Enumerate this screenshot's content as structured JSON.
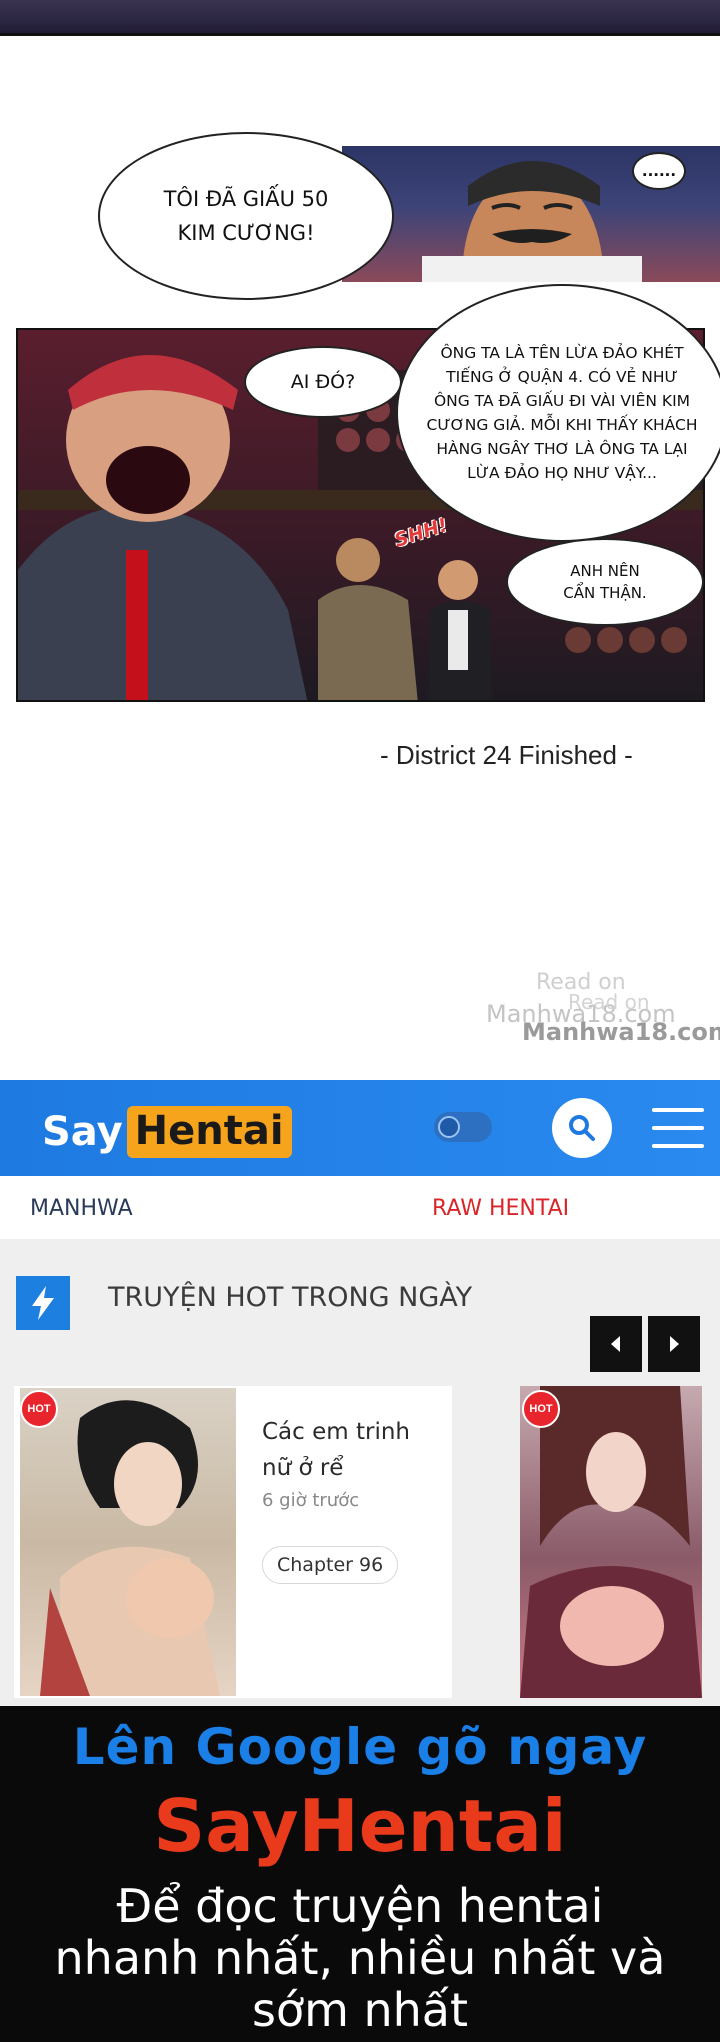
{
  "comic": {
    "bubble_1": "TÔI ĐÃ GIẤU 50\nKIM CƯƠNG!",
    "bubble_2": "AI ĐÓ?",
    "bubble_3": "ÔNG TA LÀ TÊN LỪA ĐẢO KHÉT TIẾNG Ở QUẬN 4. CÓ VẺ NHƯ ÔNG TA ĐÃ GIẤU ĐI VÀI VIÊN KIM CƯƠNG GIẢ. MỖI KHI THẤY KHÁCH HÀNG NGÂY THƠ LÀ ÔNG TA LẠI LỪA ĐẢO HỌ NHƯ VẬY...",
    "bubble_4": "ANH NÊN\nCẨN THẬN.",
    "bubble_5": "......",
    "sfx": "SHH!",
    "finished": "- District 24 Finished -",
    "watermark_read_on": "Read on",
    "watermark_site": "Manhwa18.com"
  },
  "header": {
    "logo_say": "Say",
    "logo_hentai": "Hentai",
    "theme_toggle_icon": "theme-toggle",
    "search_icon": "search-icon",
    "menu_icon": "hamburger-menu-icon",
    "color": "#2a8af0"
  },
  "nav": {
    "manhwa": "MANHWA",
    "raw_hentai": "RAW HENTAI"
  },
  "hot": {
    "section_title": "TRUYỆN HOT TRONG NGÀY",
    "section_icon": "lightning-icon",
    "prev_icon": "chevron-left-icon",
    "next_icon": "chevron-right-icon",
    "cards": [
      {
        "badge": "HOT",
        "title": "Các em trinh\nnữ ở rể",
        "time": "6 giờ trước",
        "chapter": "Chapter 96"
      },
      {
        "badge": "HOT"
      }
    ]
  },
  "promo": {
    "line1": "Lên Google gõ ngay",
    "line2": "SayHentai",
    "line3": "Để đọc truyện hentai\nnhanh nhất, nhiều nhất và\nsớm nhất"
  }
}
